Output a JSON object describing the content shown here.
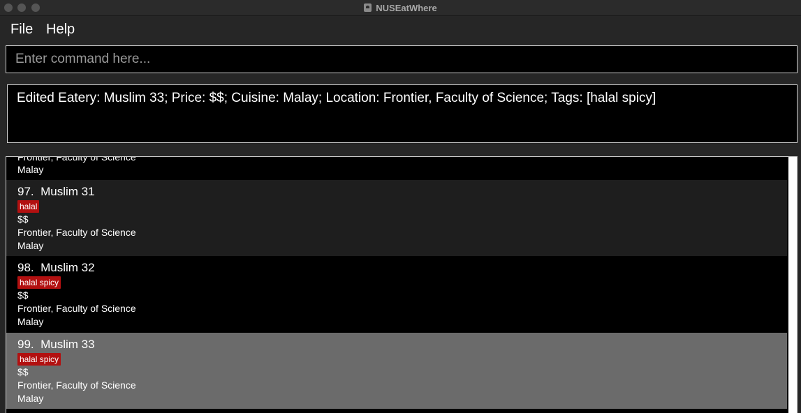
{
  "window": {
    "title": "NUSEatWhere"
  },
  "menu": {
    "file": "File",
    "help": "Help"
  },
  "command": {
    "placeholder": "Enter command here...",
    "value": ""
  },
  "result": {
    "text": "Edited Eatery: Muslim 33; Price: $$; Cuisine: Malay; Location: Frontier, Faculty of Science; Tags: [halal spicy]"
  },
  "list": {
    "partial": {
      "location": "Frontier, Faculty of Science",
      "cuisine": "Malay"
    },
    "items": [
      {
        "index": "97.",
        "name": "Muslim 31",
        "tag": "halal",
        "price": "$$",
        "location": "Frontier, Faculty of Science",
        "cuisine": "Malay"
      },
      {
        "index": "98.",
        "name": "Muslim 32",
        "tag": "halal spicy",
        "price": "$$",
        "location": "Frontier, Faculty of Science",
        "cuisine": "Malay"
      },
      {
        "index": "99.",
        "name": "Muslim 33",
        "tag": "halal spicy",
        "price": "$$",
        "location": "Frontier, Faculty of Science",
        "cuisine": "Malay",
        "selected": true
      }
    ]
  },
  "colors": {
    "tag": "#b21010",
    "selected_row": "#6b6b6b",
    "alt_row": "#1e1e1e"
  }
}
